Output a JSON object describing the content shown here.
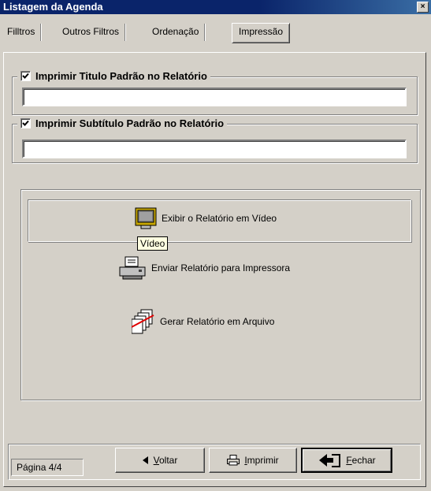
{
  "window": {
    "title": "Listagem da Agenda",
    "close": "×"
  },
  "tabs": [
    {
      "label": "Filltros"
    },
    {
      "label": "Outros Filtros"
    },
    {
      "label": "Ordenação"
    },
    {
      "label": "Impressão",
      "active": true
    }
  ],
  "title_group": {
    "label": "Imprimir Titulo Padrão no Relatório",
    "checked": true,
    "value": ""
  },
  "subtitle_group": {
    "label": "Imprimir Subtítulo Padrão no Relatório",
    "checked": true,
    "value": ""
  },
  "actions": {
    "video": {
      "label": "Exibir o Relatório em Vídeo",
      "tooltip": "Vídeo"
    },
    "printer": {
      "label": "Enviar Relatório para Impressora"
    },
    "file": {
      "label": "Gerar Relatório em Arquivo"
    }
  },
  "footer": {
    "page": "Página 4/4",
    "back": "Voltar",
    "print": "Imprimir",
    "close": "Fechar"
  }
}
